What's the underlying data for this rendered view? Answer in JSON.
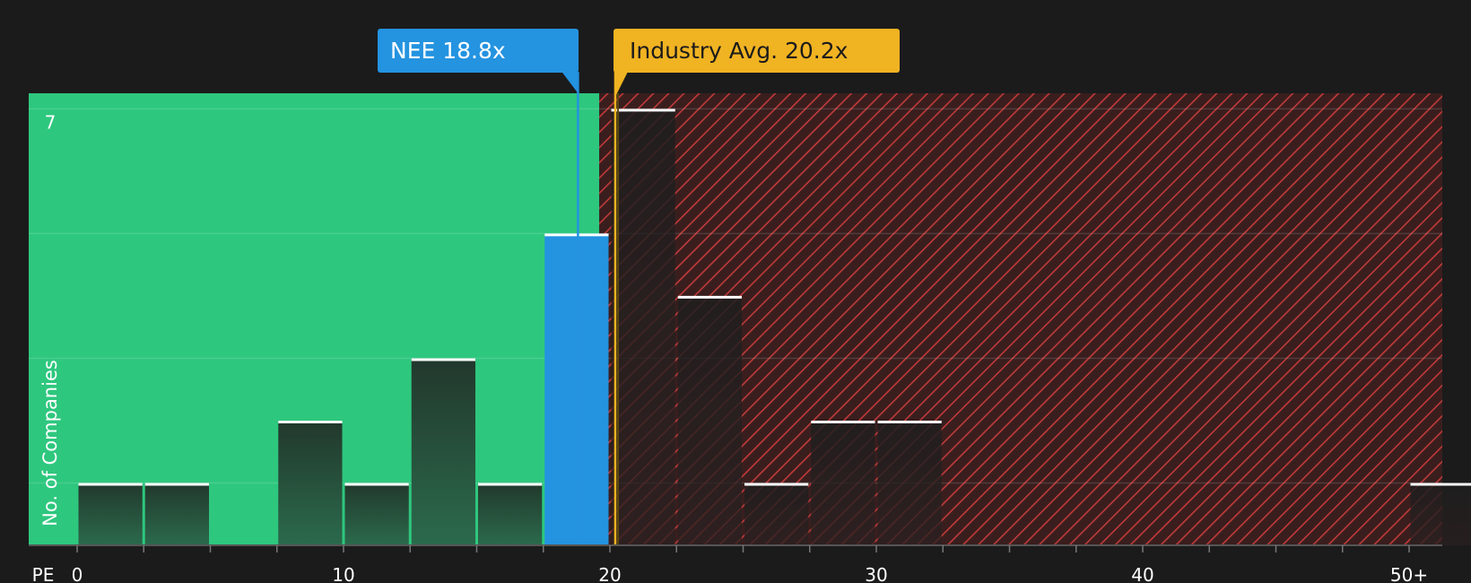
{
  "chart_data": {
    "type": "bar",
    "xlabel": "PE",
    "ylabel": "No. of Companies",
    "x_ticks": [
      {
        "value": 0,
        "label": "0"
      },
      {
        "value": 10,
        "label": "10"
      },
      {
        "value": 20,
        "label": "20"
      },
      {
        "value": 30,
        "label": "30"
      },
      {
        "value": 40,
        "label": "40"
      },
      {
        "value": 50,
        "label": "50+"
      }
    ],
    "y_ticks": [
      {
        "value": 7,
        "label": "7"
      }
    ],
    "xlim": [
      0,
      51.3
    ],
    "ylim": [
      0,
      7.25
    ],
    "bin_width": 2.5,
    "bins": [
      {
        "start": 0,
        "count": 1
      },
      {
        "start": 2.5,
        "count": 1
      },
      {
        "start": 5,
        "count": 0
      },
      {
        "start": 7.5,
        "count": 2
      },
      {
        "start": 10,
        "count": 1
      },
      {
        "start": 12.5,
        "count": 3
      },
      {
        "start": 15,
        "count": 1
      },
      {
        "start": 17.5,
        "count": 5,
        "highlight": true
      },
      {
        "start": 20,
        "count": 7
      },
      {
        "start": 22.5,
        "count": 4
      },
      {
        "start": 25,
        "count": 1
      },
      {
        "start": 27.5,
        "count": 2
      },
      {
        "start": 30,
        "count": 2
      },
      {
        "start": 32.5,
        "count": 0
      },
      {
        "start": 35,
        "count": 0
      },
      {
        "start": 37.5,
        "count": 0
      },
      {
        "start": 40,
        "count": 0
      },
      {
        "start": 42.5,
        "count": 0
      },
      {
        "start": 45,
        "count": 0
      },
      {
        "start": 47.5,
        "count": 0
      },
      {
        "start": 50,
        "count": 1
      }
    ],
    "company": {
      "label": "NEE 18.8x",
      "value": 18.8
    },
    "industry_avg": {
      "label": "Industry Avg. 20.2x",
      "value": 20.2
    },
    "undervalued_zone_end": 19.6,
    "grid": true,
    "colors": {
      "background": "#1b1b1b",
      "undervalued": "#2ec77e",
      "overvalued_stripe": "#c13a3a",
      "company": "#2493e0",
      "industry": "#f0b322",
      "bar_dark": "#26332e"
    }
  }
}
